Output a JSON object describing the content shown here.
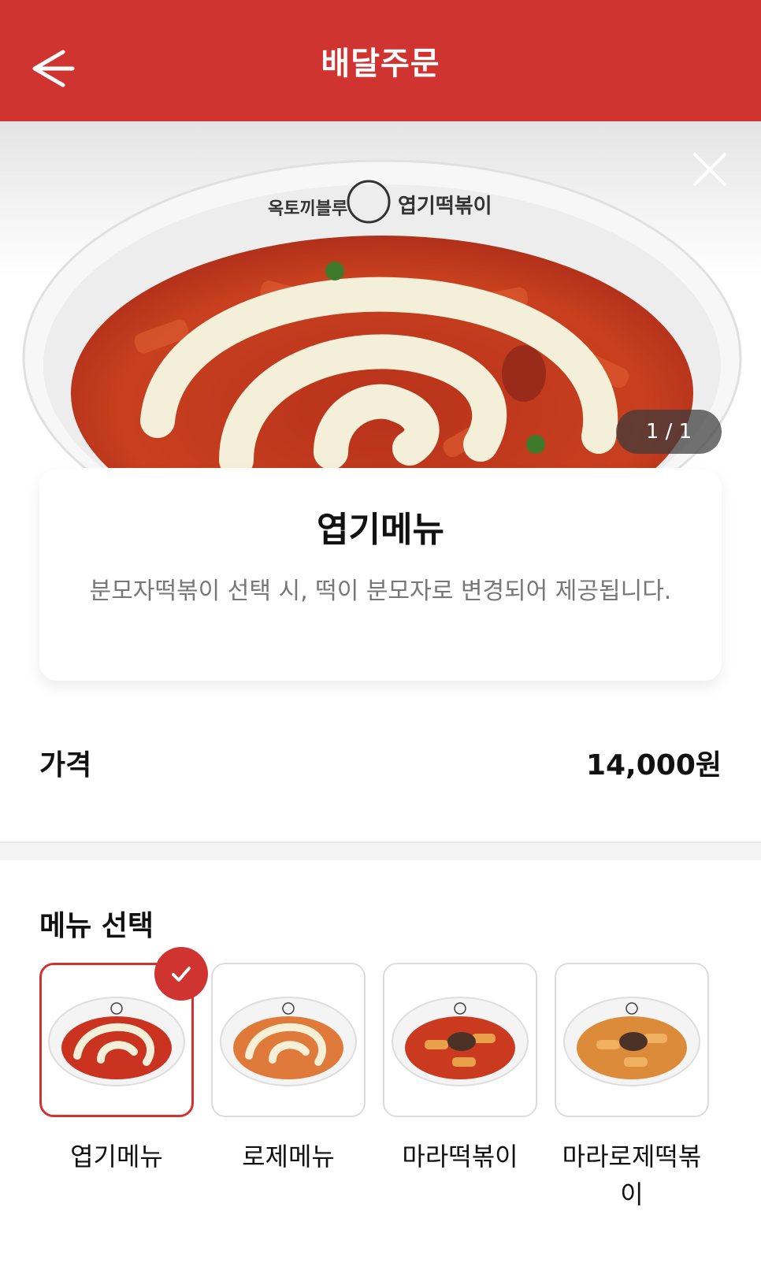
{
  "header": {
    "title": "배달주문"
  },
  "hero": {
    "pager": "1 / 1",
    "bowl_logo": "옥토끼블루 엽기떡볶이"
  },
  "product": {
    "name": "엽기메뉴",
    "description": "분모자떡볶이 선택 시, 떡이 분모자로 변경되어 제공됩니다."
  },
  "price": {
    "label": "가격",
    "value": "14,000원"
  },
  "menu_selection": {
    "title": "메뉴 선택",
    "items": [
      {
        "label": "엽기메뉴",
        "selected": true,
        "sauce_color": "#c9331f"
      },
      {
        "label": "로제메뉴",
        "selected": false,
        "sauce_color": "#e07a3a"
      },
      {
        "label": "마라떡볶이",
        "selected": false,
        "sauce_color": "#c93a1f"
      },
      {
        "label": "마라로제떡볶이",
        "selected": false,
        "sauce_color": "#dc8b3a"
      }
    ]
  },
  "colors": {
    "brand": "#cf3431",
    "description_text": "#777777"
  }
}
